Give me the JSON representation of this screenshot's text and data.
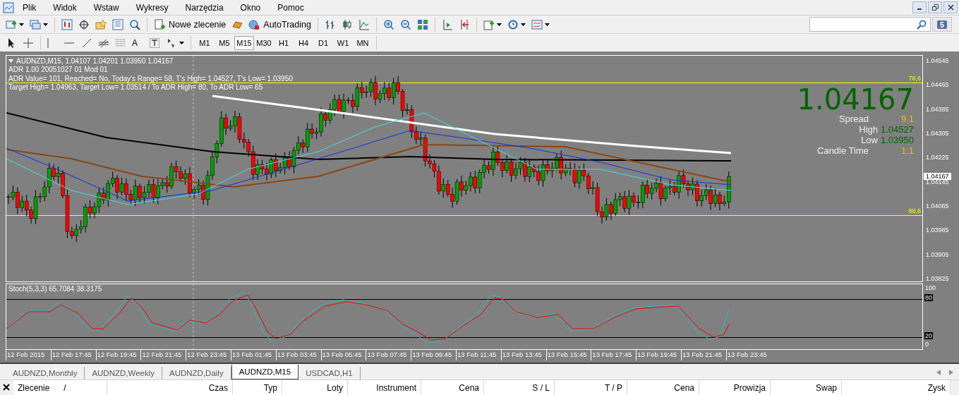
{
  "menu": [
    "Plik",
    "Widok",
    "Wstaw",
    "Wykresy",
    "Narzędzia",
    "Okno",
    "Pomoc"
  ],
  "toolbar": {
    "new_order": "Nowe zlecenie",
    "autotrading": "AutoTrading",
    "notifications": "5"
  },
  "drawing_tools": {
    "text_tool": "A"
  },
  "timeframes": [
    {
      "label": "M1",
      "selected": false
    },
    {
      "label": "M5",
      "selected": false
    },
    {
      "label": "M15",
      "selected": true
    },
    {
      "label": "M30",
      "selected": false
    },
    {
      "label": "H1",
      "selected": false
    },
    {
      "label": "H4",
      "selected": false
    },
    {
      "label": "D1",
      "selected": false
    },
    {
      "label": "W1",
      "selected": false
    },
    {
      "label": "MN",
      "selected": false
    }
  ],
  "chart": {
    "title": "AUDNZD,M15, 1.04107 1.04201 1.03950 1.04167",
    "info_lines": [
      "ADR 1.00 20051027 01 Mod 01",
      "ADR Value= 101, Reached= No, Today's Range= 58, T's High= 1.04527, T's Low= 1.03950",
      "Target High= 1.04963, Target Low= 1.03514 / To ADR High= 80, To ADR Low= 65"
    ],
    "levels": [
      "78,6",
      "88,6"
    ],
    "last_price": "1.04167",
    "stats": [
      {
        "label": "Spread",
        "value": "9.1",
        "color": "#e8c000"
      },
      {
        "label": "High",
        "value": "1.04527",
        "color": "#006400"
      },
      {
        "label": "Low",
        "value": "1.03950",
        "color": "#006400"
      },
      {
        "label": "Candle Time",
        "value": "1:1",
        "color": "#e8c000"
      }
    ],
    "price_axis": [
      "1.04545",
      "1.04465",
      "1.04385",
      "1.04305",
      "1.04225",
      "1.04145",
      "1.04065",
      "1.03985",
      "1.03905",
      "1.03825"
    ],
    "price_tag": "1.04167"
  },
  "indicator": {
    "title": "Stoch(5,3,3) 65.7084 38.3175",
    "axis": [
      {
        "label": "100",
        "kind": "plain"
      },
      {
        "label": "80",
        "kind": "tag"
      },
      {
        "label": "20",
        "kind": "tag"
      },
      {
        "label": "0",
        "kind": "plain"
      }
    ]
  },
  "time_axis": [
    "12 Feb 2015",
    "12 Feb 17:45",
    "12 Feb 19:45",
    "12 Feb 21:45",
    "12 Feb 23:45",
    "13 Feb 01:45",
    "13 Feb 03:45",
    "13 Feb 05:45",
    "13 Feb 07:45",
    "13 Feb 09:45",
    "13 Feb 11:45",
    "13 Feb 13:45",
    "13 Feb 15:45",
    "13 Feb 17:45",
    "13 Feb 19:45",
    "13 Feb 21:45",
    "13 Feb 23:45"
  ],
  "tabs": [
    {
      "label": "AUDNZD,Monthly",
      "selected": false
    },
    {
      "label": "AUDNZD,Weekly",
      "selected": false
    },
    {
      "label": "AUDNZD,Daily",
      "selected": false
    },
    {
      "label": "AUDNZD,M15",
      "selected": true
    },
    {
      "label": "USDCAD,H1",
      "selected": false
    }
  ],
  "terminal": {
    "columns": [
      {
        "label": "Zlecenie",
        "sort_mark": "/"
      },
      {
        "label": "Czas"
      },
      {
        "label": "Typ"
      },
      {
        "label": "Loty"
      },
      {
        "label": "Instrument"
      },
      {
        "label": "Cena"
      },
      {
        "label": "S / L"
      },
      {
        "label": "T / P"
      },
      {
        "label": "Cena"
      },
      {
        "label": "Prowizja"
      },
      {
        "label": "Swap"
      },
      {
        "label": "Zysk"
      }
    ]
  }
}
